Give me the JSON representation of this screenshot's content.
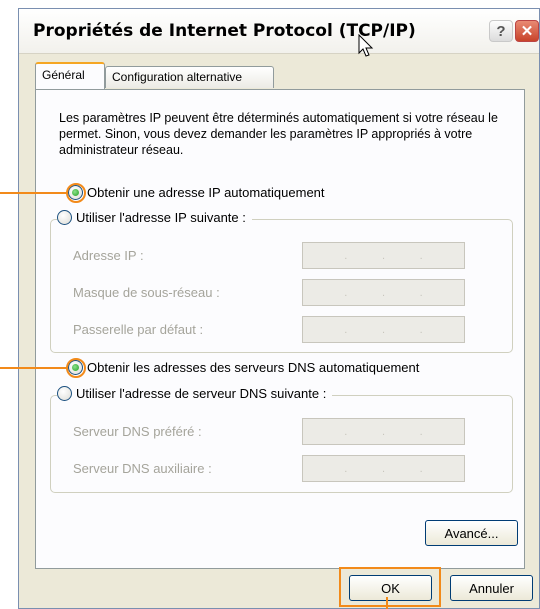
{
  "window": {
    "title": "Propriétés de Internet Protocol (TCP/IP)",
    "help_glyph": "?",
    "close_glyph": "✕"
  },
  "tabs": [
    {
      "label": "Général",
      "active": true
    },
    {
      "label": "Configuration alternative",
      "active": false
    }
  ],
  "intro": "Les paramètres IP peuvent être déterminés automatiquement si votre réseau le permet. Sinon, vous devez demander les paramètres IP appropriés à votre administrateur réseau.",
  "ip": {
    "auto_label": "Obtenir une adresse IP automatiquement",
    "auto_selected": true,
    "manual_label": "Utiliser l'adresse IP suivante :",
    "fields": [
      {
        "label": "Adresse IP :"
      },
      {
        "label": "Masque de sous-réseau :"
      },
      {
        "label": "Passerelle par défaut :"
      }
    ]
  },
  "dns": {
    "auto_label": "Obtenir les adresses des serveurs DNS automatiquement",
    "auto_selected": true,
    "manual_label": "Utiliser l'adresse de serveur DNS suivante :",
    "fields": [
      {
        "label": "Serveur DNS préféré :"
      },
      {
        "label": "Serveur DNS auxiliaire :"
      }
    ]
  },
  "buttons": {
    "advanced": "Avancé...",
    "ok": "OK",
    "cancel": "Annuler"
  },
  "colors": {
    "accent": "#f28a1a",
    "radio_dot": "#21a121"
  }
}
